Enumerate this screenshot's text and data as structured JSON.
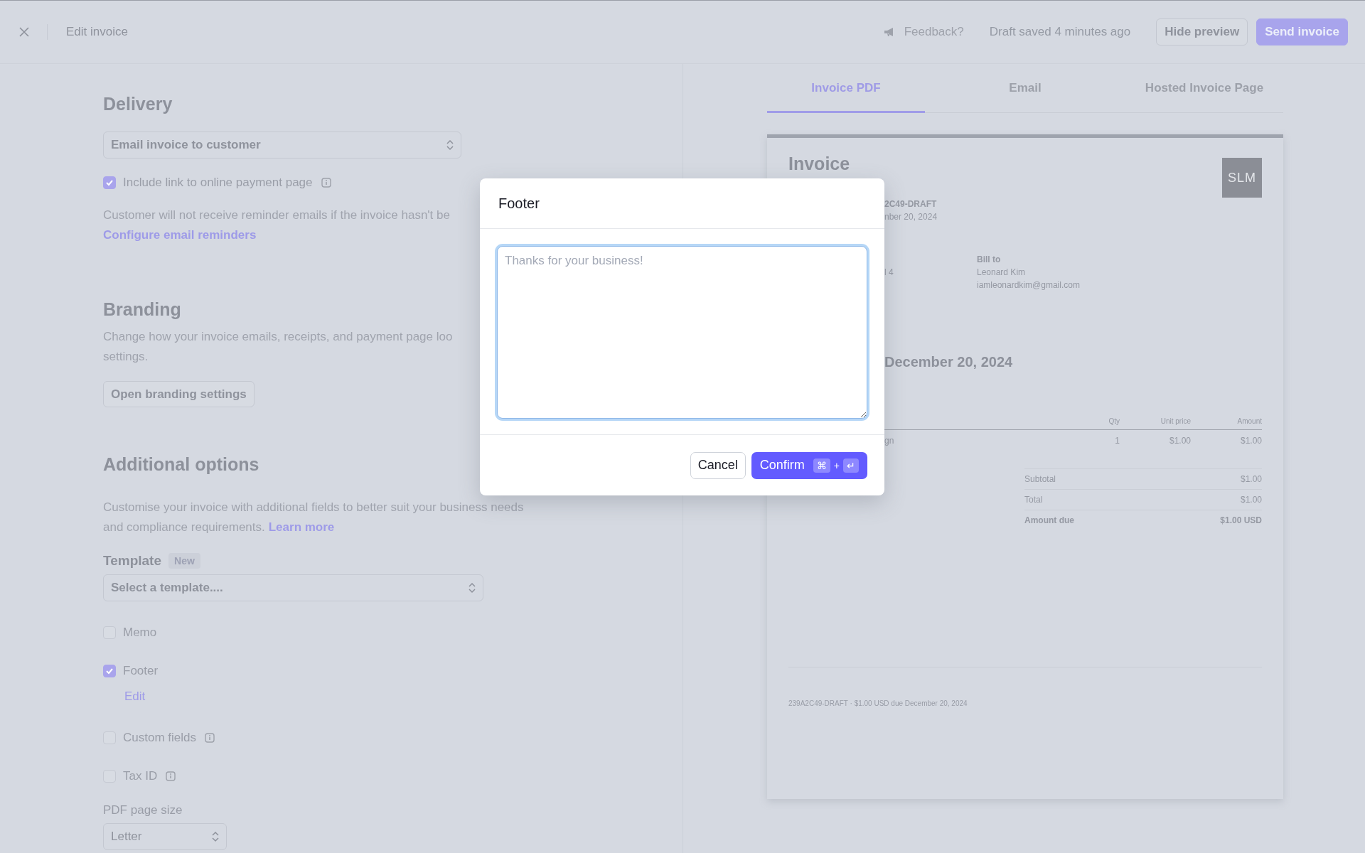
{
  "top_bar": {
    "title": "Edit invoice",
    "feedback": "Feedback?",
    "status": "Draft saved 4 minutes ago",
    "buttons": [
      {
        "label": "Hide preview",
        "kind": "secondary"
      },
      {
        "label": "Send invoice",
        "kind": "primary"
      }
    ]
  },
  "delivery": {
    "title": "Delivery",
    "method": "Email invoice to customer",
    "include_link": {
      "label": "Include link to online payment page",
      "checked": true,
      "info": true
    },
    "note": "Customer will not receive reminder emails if the invoice hasn't be",
    "link": "Configure email reminders"
  },
  "branding": {
    "title": "Branding",
    "description": [
      "Change how your invoice emails, receipts, and payment page loo",
      "settings."
    ],
    "button": "Open branding settings"
  },
  "additional_options": {
    "title": "Additional options",
    "description": [
      "Customise your invoice with additional fields to better suit your business needs",
      "and compliance requirements."
    ],
    "link": "Learn more",
    "template": {
      "label": "Template",
      "badge": "New",
      "placeholder": "Select a template...."
    },
    "options": [
      {
        "label": "Memo",
        "checked": false,
        "info": false
      },
      {
        "label": "Footer",
        "checked": true,
        "info": false,
        "action": "Edit"
      },
      {
        "label": "Custom fields",
        "checked": false,
        "info": true
      },
      {
        "label": "Tax ID",
        "checked": false,
        "info": true
      }
    ],
    "page_size": {
      "label": "PDF page size",
      "value": "Letter"
    }
  },
  "preview": {
    "tabs": [
      {
        "label": "Invoice PDF",
        "selected": true
      },
      {
        "label": "Email",
        "selected": false
      },
      {
        "label": "Hosted Invoice Page",
        "selected": false
      }
    ],
    "invoice": {
      "title": "Invoice",
      "logo_text": "SLM",
      "number": "2C49-DRAFT",
      "date": "nber 20, 2024",
      "from_line": "l 4",
      "bill_to": {
        "label": "Bill to",
        "lines": [
          "Leonard Kim",
          "iamleonardkim@gmail.com"
        ]
      },
      "due_heading": "December 20, 2024",
      "columns": [
        "Qty",
        "Unit price",
        "Amount"
      ],
      "rows": [
        {
          "description": "gn",
          "qty": "1",
          "unit_price": "$1.00",
          "amount": "$1.00"
        }
      ],
      "totals": [
        {
          "label": "Subtotal",
          "value": "$1.00",
          "bold": false
        },
        {
          "label": "Total",
          "value": "$1.00",
          "bold": false
        },
        {
          "label": "Amount due",
          "value": "$1.00 USD",
          "bold": true
        }
      ],
      "footer": "239A2C49-DRAFT · $1.00 USD due December 20, 2024"
    }
  },
  "modal": {
    "title": "Footer",
    "placeholder": "Thanks for your business!",
    "cancel": "Cancel",
    "confirm": "Confirm",
    "shortcut": {
      "keys": [
        "⌘",
        "↵"
      ],
      "joiner": "+"
    }
  }
}
